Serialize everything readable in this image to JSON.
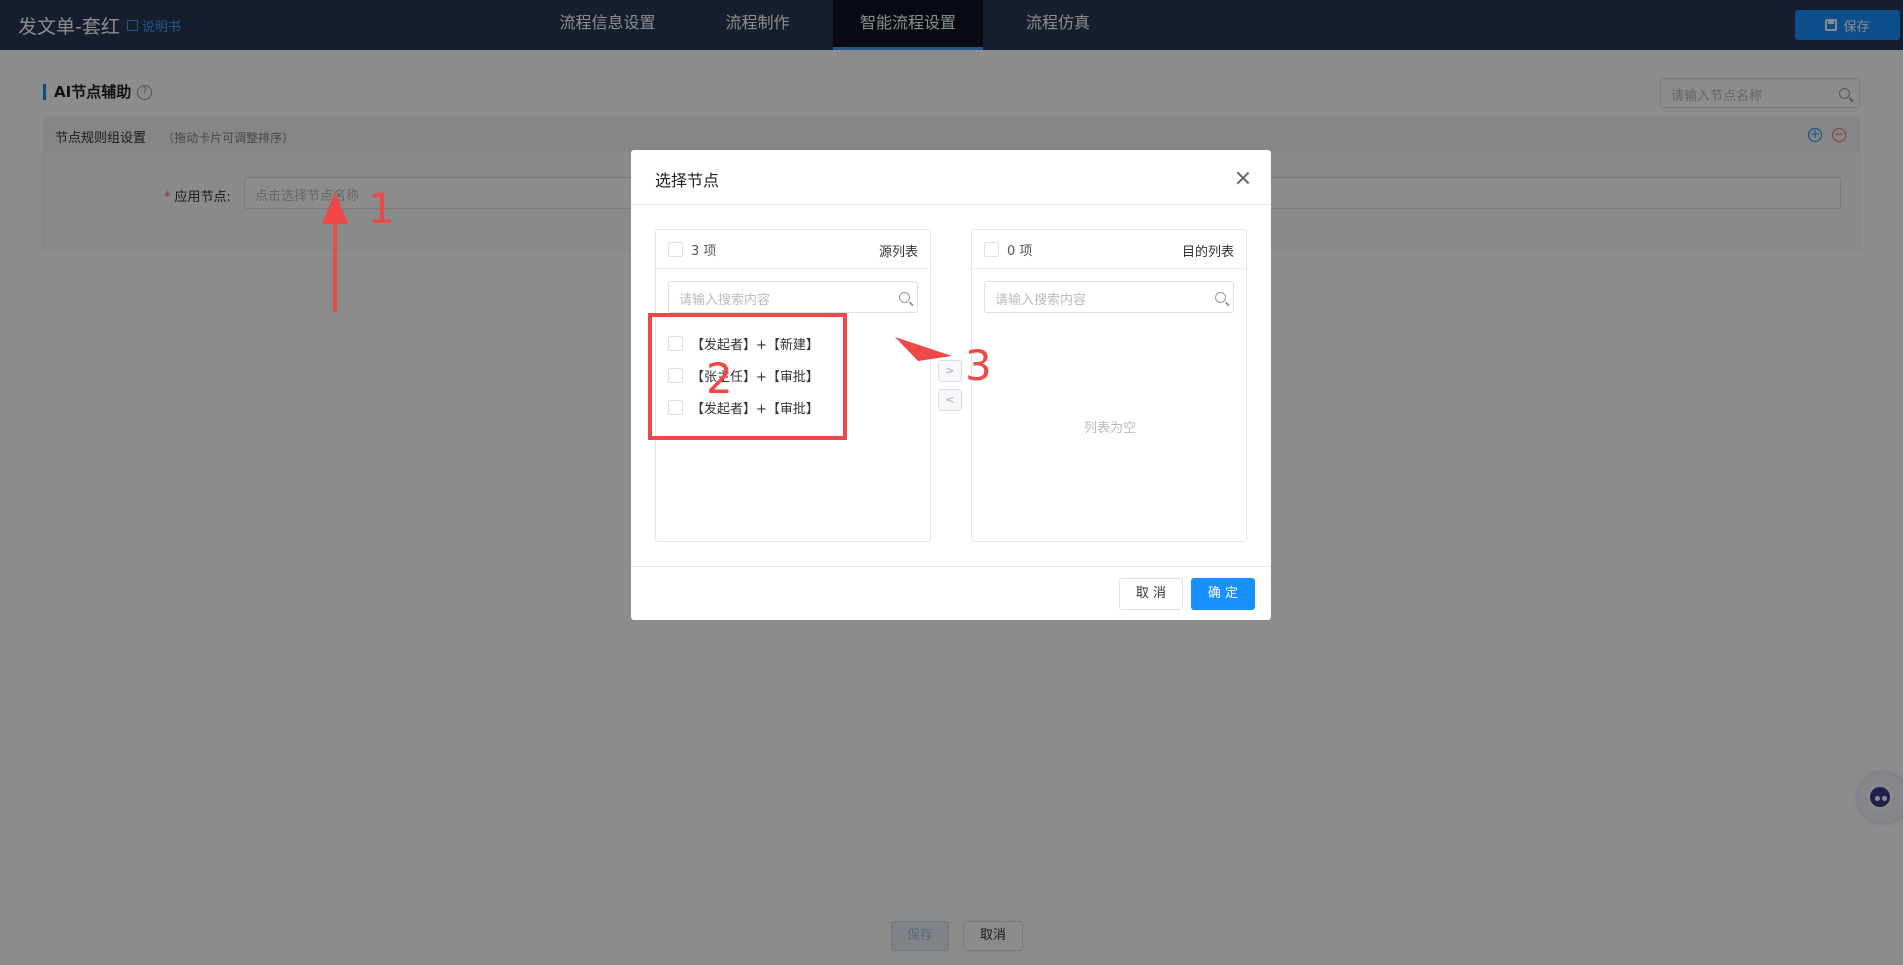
{
  "header": {
    "title": "发文单-套红",
    "manual_label": "说明书",
    "tabs": [
      {
        "label": "流程信息设置"
      },
      {
        "label": "流程制作"
      },
      {
        "label": "智能流程设置"
      },
      {
        "label": "流程仿真"
      }
    ],
    "active_tab": 2,
    "save_label": "保存"
  },
  "section": {
    "title": "AI节点辅助",
    "search_placeholder": "请输入节点名称"
  },
  "rule_group": {
    "title": "节点规则组设置",
    "hint": "（拖动卡片可调整排序）",
    "apply_label": "应用节点:",
    "apply_placeholder": "点击选择节点名称"
  },
  "footer": {
    "save_label": "保存",
    "cancel_label": "取消"
  },
  "dialog": {
    "title": "选择节点",
    "source": {
      "count": "3 项",
      "title": "源列表",
      "search_placeholder": "请输入搜索内容",
      "items": [
        {
          "label": "【发起者】+【新建】"
        },
        {
          "label": "【张主任】+【审批】"
        },
        {
          "label": "【发起者】+【审批】"
        }
      ]
    },
    "target": {
      "count": "0 项",
      "title": "目的列表",
      "search_placeholder": "请输入搜索内容",
      "empty_text": "列表为空"
    },
    "cancel_label": "取 消",
    "ok_label": "确 定"
  },
  "annotations": {
    "step1": "1",
    "step2": "2",
    "step3": "3",
    "color": "#f04848"
  },
  "colors": {
    "header_bg": "#2b3a55",
    "accent": "#1890ff",
    "danger": "#f56c6c"
  }
}
